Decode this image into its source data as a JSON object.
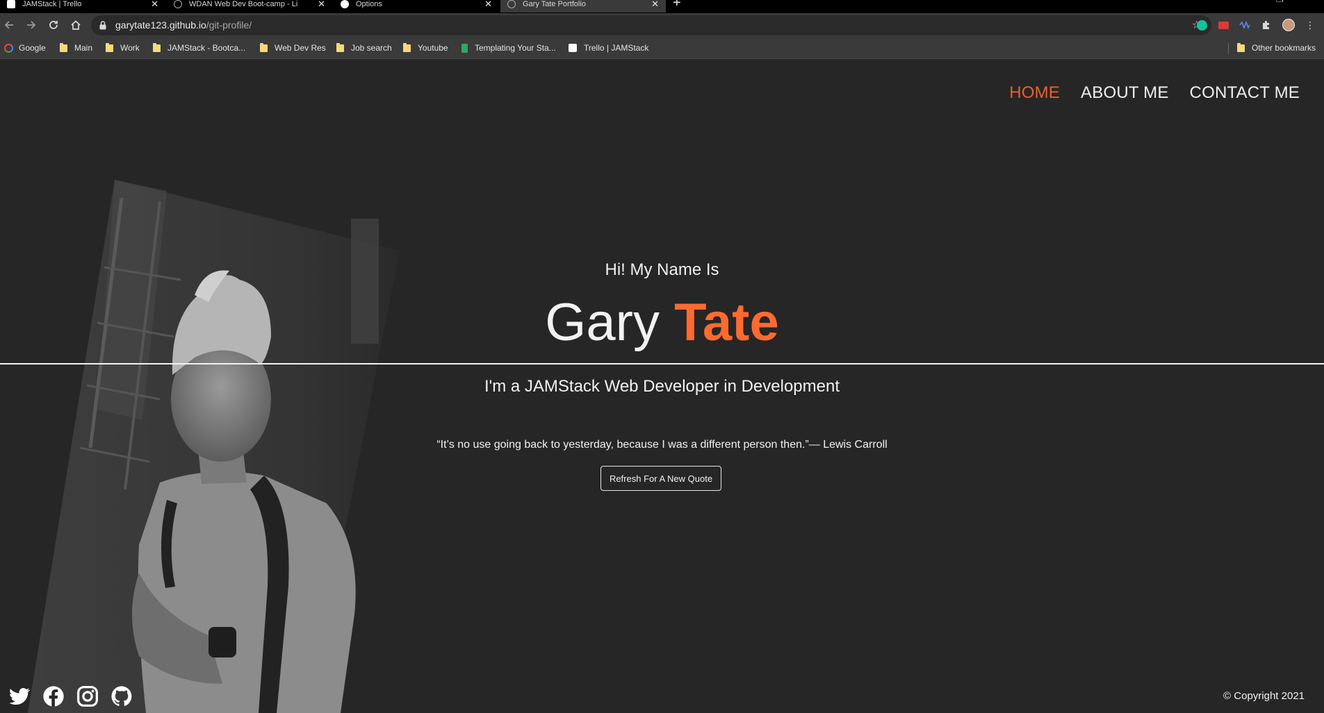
{
  "browser": {
    "tabs": [
      {
        "title": "JAMStack | Trello"
      },
      {
        "title": "WDAN Web Dev Boot-camp - Li"
      },
      {
        "title": "Options"
      },
      {
        "title": "Gary Tate Portfolio"
      }
    ],
    "new_tab_label": "+",
    "url_host": "garytate123.github.io",
    "url_path": "/git-profile/",
    "bookmarks": [
      {
        "label": "Google"
      },
      {
        "label": "Main"
      },
      {
        "label": "Work"
      },
      {
        "label": "JAMStack - Bootca..."
      },
      {
        "label": "Web Dev Res"
      },
      {
        "label": "Job search"
      },
      {
        "label": "Youtube"
      },
      {
        "label": "Templating Your Sta..."
      },
      {
        "label": "Trello | JAMStack"
      }
    ],
    "other_bookmarks": "Other bookmarks"
  },
  "nav": {
    "home": "HOME",
    "about": "ABOUT ME",
    "contact": "CONTACT ME"
  },
  "hero": {
    "greeting": "Hi! My Name Is",
    "first_name": "Gary",
    "last_name": "Tate",
    "tagline": "I'm a JAMStack Web Developer in Development",
    "quote": "“It’s no use going back to yesterday, because I was a different person then.”— Lewis Carroll",
    "refresh_button": "Refresh For A New Quote"
  },
  "footer": {
    "social_icons": [
      "twitter-icon",
      "facebook-icon",
      "instagram-icon",
      "github-icon"
    ],
    "copyright": "© Copyright 2021"
  },
  "colors": {
    "background": "#262626",
    "accent": "#ff6a30",
    "text": "#f2f2f2"
  }
}
